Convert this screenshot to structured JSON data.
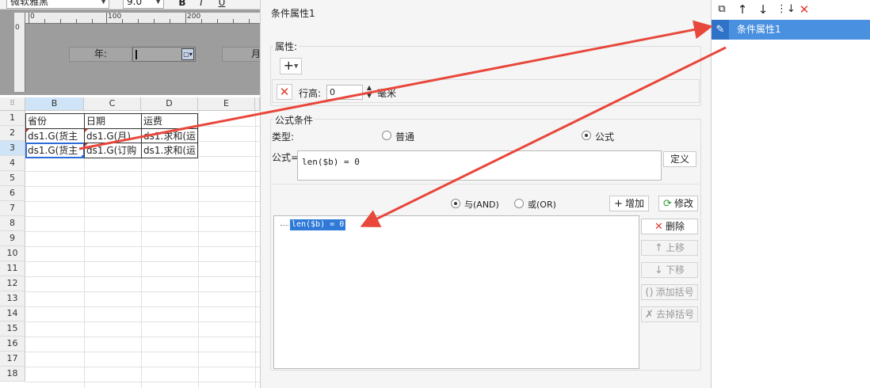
{
  "toolbar": {
    "font_name": "微软雅黑",
    "font_size": "9.0",
    "bold_label": "B",
    "italic_label": "I",
    "underline_label": "U"
  },
  "designer": {
    "ruler_marks": [
      "0",
      "100",
      "200"
    ],
    "ruler_v_mark": "0",
    "param_year_label": "年:",
    "param_month_label": "月:"
  },
  "sheet": {
    "corner_glyph": "⠿",
    "columns": [
      "B",
      "C",
      "D",
      "E"
    ],
    "rows": [
      "1",
      "2",
      "3",
      "4",
      "5",
      "6",
      "7",
      "8",
      "9",
      "10",
      "11",
      "12",
      "13",
      "14",
      "15",
      "16",
      "17",
      "18"
    ],
    "cells": {
      "b1": "省份",
      "c1": "日期",
      "d1": "运费",
      "b2": "ds1.G(货主",
      "c2": "ds1.G(月)",
      "d2": "ds1.求和(运",
      "b3": "ds1.G(货主",
      "c3": "ds1.G(订购",
      "d3": "ds1.求和(运"
    }
  },
  "dialog": {
    "title": "条件属性1",
    "attr_group_title": "属性:",
    "add_glyph": "+",
    "row_height_label": "行高:",
    "row_height_value": "0",
    "unit_label": "毫米",
    "formula_group_title": "公式条件",
    "type_label": "类型:",
    "radio_normal": "普通",
    "radio_formula": "公式",
    "formula_label": "公式=",
    "formula_value": "len($b) = 0",
    "define_button": "定义",
    "radio_and": "与(AND)",
    "radio_or": "或(OR)",
    "add_button": "增加",
    "modify_button": "修改",
    "delete_button": "删除",
    "move_up_button": "上移",
    "move_down_button": "下移",
    "add_bracket_button": "添加括号",
    "remove_bracket_button": "去掉括号",
    "list_items": [
      "len($b) = 0"
    ]
  },
  "right_panel": {
    "item_label": "条件属性1"
  },
  "colors": {
    "accent": "#2f7ad8",
    "arrow": "#e8473b",
    "danger": "#e03a2e"
  }
}
